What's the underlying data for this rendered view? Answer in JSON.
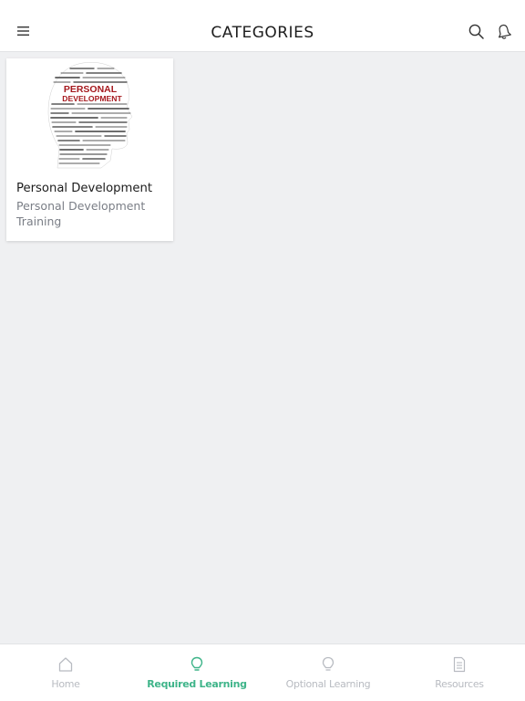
{
  "header": {
    "title": "CATEGORIES",
    "menu_icon": "hamburger-menu-icon",
    "search_icon": "search-icon",
    "bell_icon": "bell-icon"
  },
  "categories": [
    {
      "title": "Personal Development",
      "subtitle": "Personal Development Training",
      "image": {
        "description_icon": "head-word-cloud-image",
        "word_1": "PERSONAL",
        "word_2": "DEVELOPMENT"
      }
    }
  ],
  "tabbar": {
    "items": [
      {
        "label": "Home",
        "icon": "home-icon",
        "active": false
      },
      {
        "label": "Required Learning",
        "icon": "lightbulb-icon",
        "active": true
      },
      {
        "label": "Optional Learning",
        "icon": "lightbulb-icon",
        "active": false
      },
      {
        "label": "Resources",
        "icon": "document-icon",
        "active": false
      }
    ]
  },
  "colors": {
    "accent": "#3eb489",
    "inactive": "#b8bbc1",
    "background": "#eff0f2",
    "image_text": "#a5191e"
  }
}
